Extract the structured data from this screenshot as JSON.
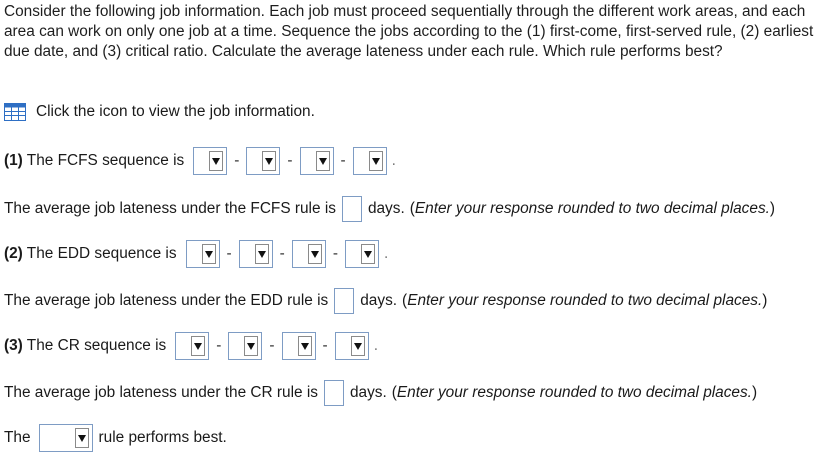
{
  "intro": "Consider the following job information. Each job must proceed sequentially through the different work areas, and each area can work on only one job at a time. Sequence the jobs according to the (1) first-come, first-served rule, (2) earliest due date, and (3) critical ratio. Calculate the average lateness under each rule. Which rule performs best?",
  "info_link": "Click the icon to view the job information.",
  "q1": {
    "label_bold": "(1)",
    "label_text": " The FCFS sequence is",
    "avg_text": "The average job lateness under the FCFS rule is",
    "avg_value": ""
  },
  "q2": {
    "label_bold": "(2)",
    "label_text": " The EDD sequence is",
    "avg_text": "The average job lateness under the EDD rule is",
    "avg_value": ""
  },
  "q3": {
    "label_bold": "(3)",
    "label_text": " The CR sequence is",
    "avg_text": "The average job lateness under the CR rule is",
    "avg_value": ""
  },
  "days_text": "days.",
  "hint_open": "(",
  "hint_text": "Enter your response rounded to two decimal places.",
  "hint_close": ")",
  "dash": "-",
  "period": ".",
  "final": {
    "before": "The",
    "after": "rule performs best."
  },
  "colors": {
    "input_border": "#7e9cc4",
    "icon_blue": "#2e6fc4"
  },
  "icons": {
    "info": "table-grid-icon",
    "dropdown": "triangle-down-icon"
  }
}
